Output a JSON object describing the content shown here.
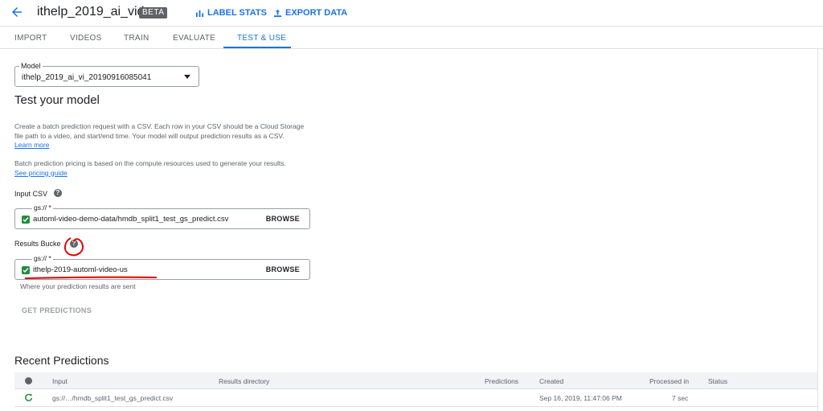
{
  "header": {
    "title": "ithelp_2019_ai_video",
    "badge": "BETA",
    "label_stats": "LABEL STATS",
    "export_data": "EXPORT DATA"
  },
  "tabs": [
    {
      "label": "IMPORT"
    },
    {
      "label": "VIDEOS"
    },
    {
      "label": "TRAIN"
    },
    {
      "label": "EVALUATE"
    },
    {
      "label": "TEST & USE"
    }
  ],
  "model": {
    "legend": "Model",
    "value": "ithelp_2019_ai_vi_20190916085041"
  },
  "test": {
    "title": "Test your model",
    "desc_line1": "Create a batch prediction request with a CSV. Each row in your CSV should be a Cloud Storage",
    "desc_line2": "file path to a video, and start/end time. Your model will output prediction results as a CSV.",
    "learn_more": "Learn more",
    "pricing_line": "Batch prediction pricing is based on the compute resources used to generate your results.",
    "pricing_link": "See pricing guide"
  },
  "input_csv": {
    "label": "Input CSV",
    "legend": "gs:// *",
    "value": "automl-video-demo-data/hmdb_split1_test_gs_predict.csv",
    "button": "BROWSE"
  },
  "results_bucket": {
    "label": "Results Bucke",
    "legend": "gs:// *",
    "value": "ithelp-2019-automl-video-us",
    "button": "BROWSE",
    "hint": "Where your prediction results are sent"
  },
  "get_predictions": "GET PREDICTIONS",
  "recent": {
    "title": "Recent Predictions",
    "columns": [
      "Input",
      "Results directory",
      "Predictions",
      "Created",
      "Processed in",
      "Status"
    ],
    "rows": [
      {
        "input": "gs://…/hmdb_split1_test_gs_predict.csv",
        "results_directory": "",
        "predictions": "",
        "created": "Sep 16, 2019, 11:47:06 PM",
        "processed_in": "7 sec",
        "status": ""
      }
    ]
  },
  "colors": {
    "accent": "#1a73e8",
    "success": "#1e8e3e",
    "annotation": "#e00000"
  }
}
